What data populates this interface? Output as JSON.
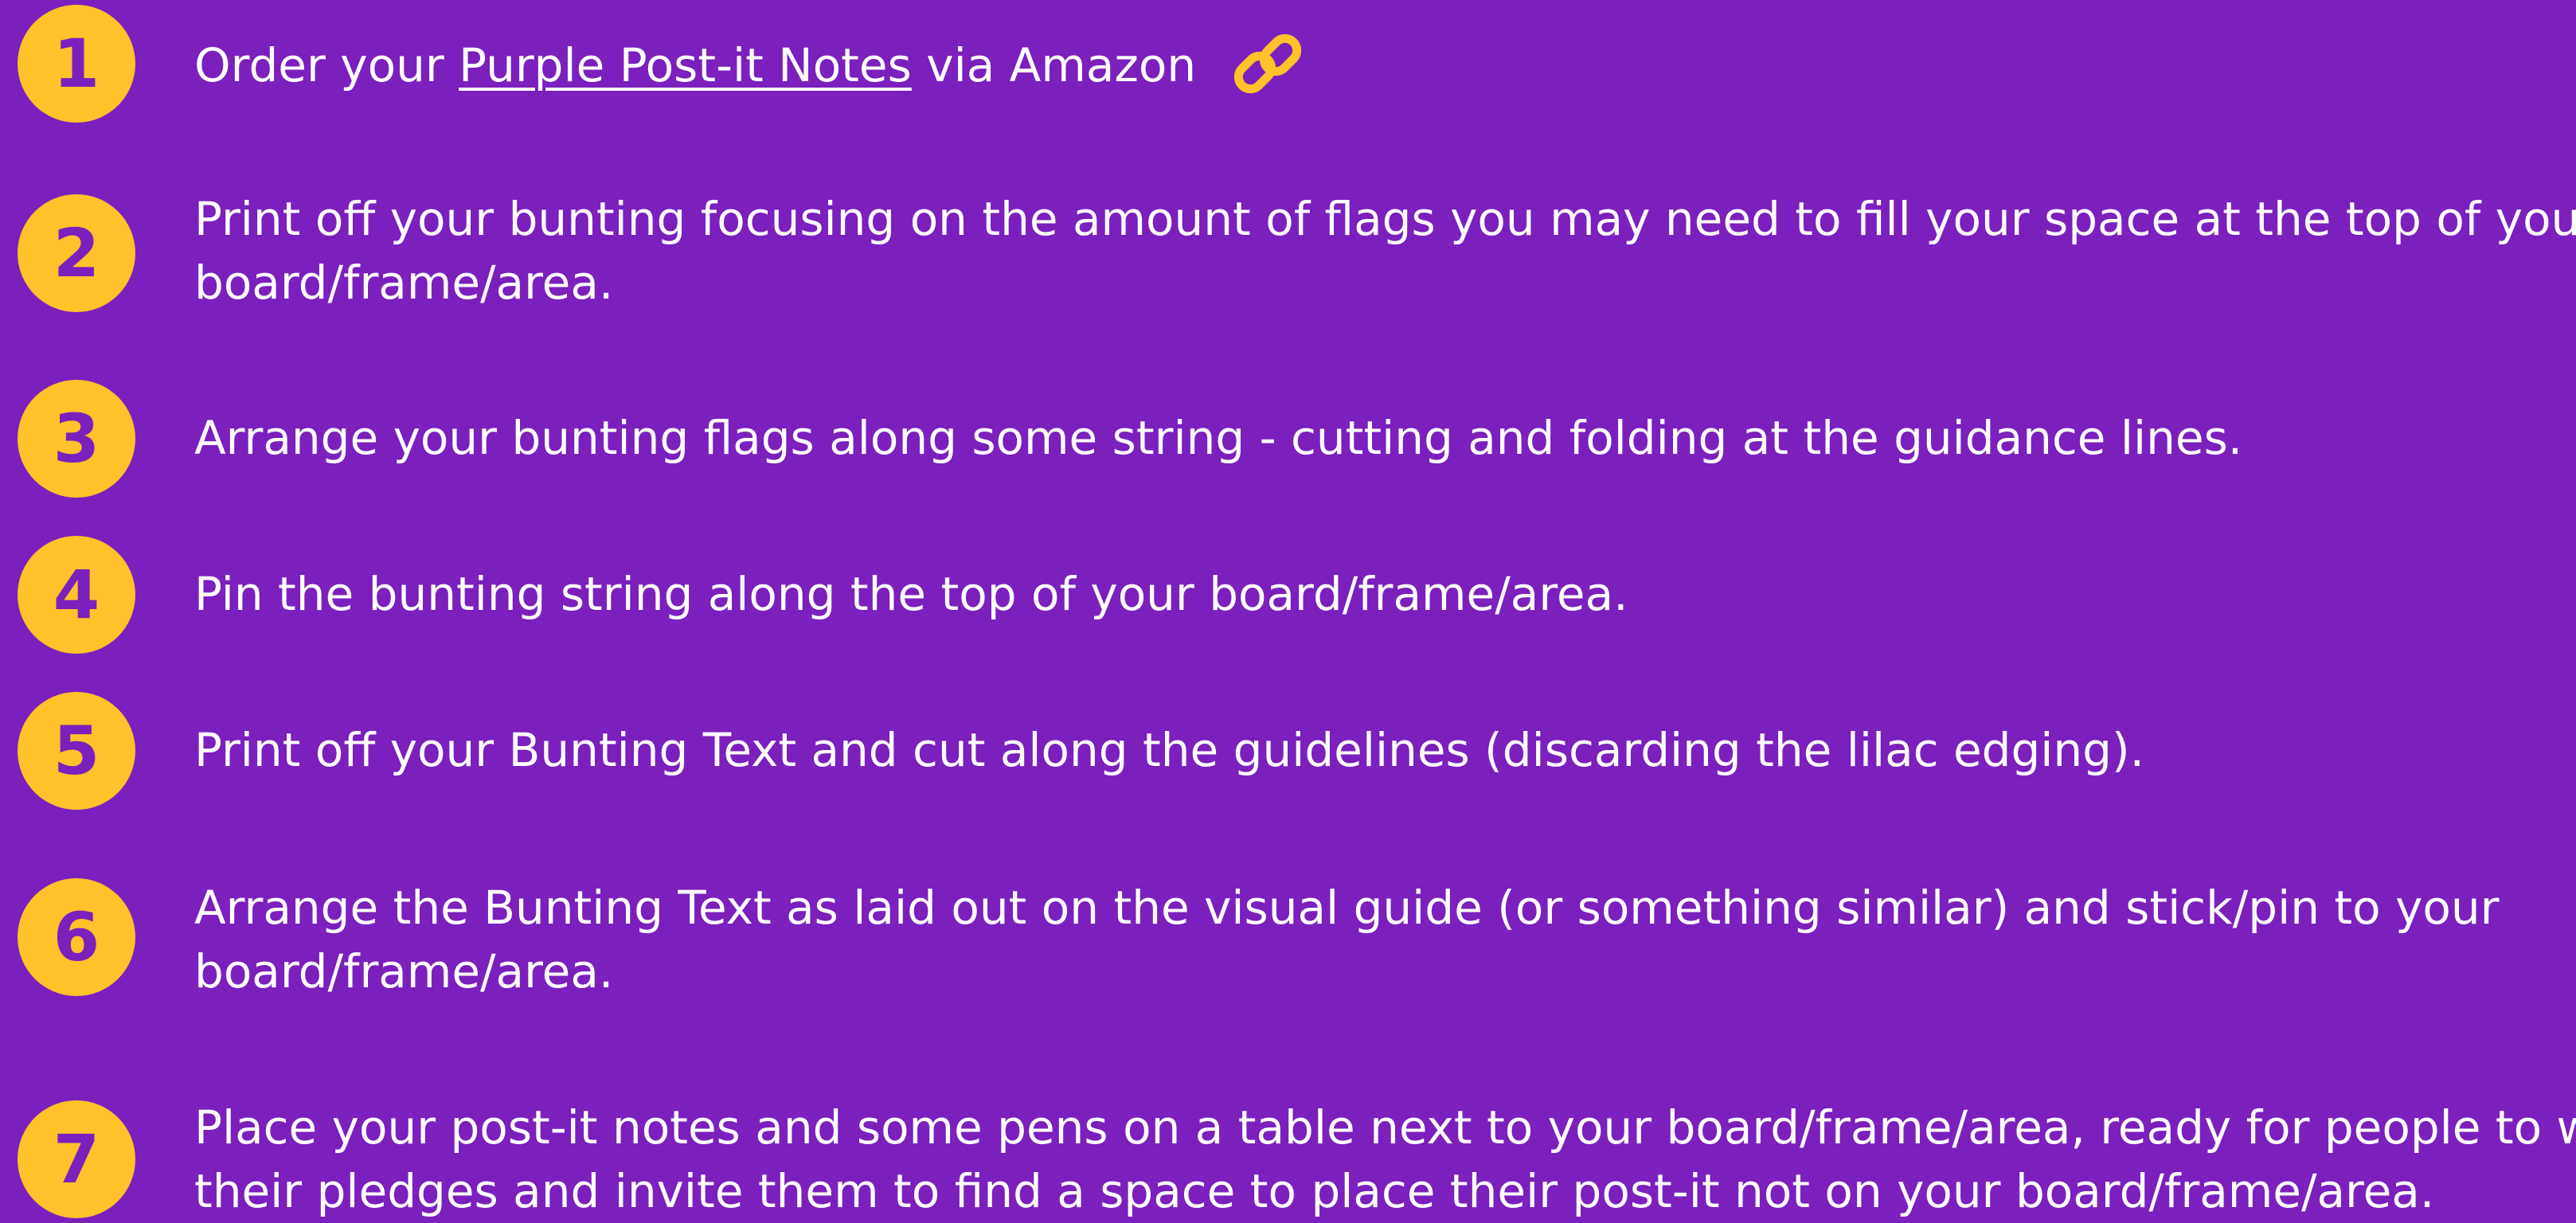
{
  "colors": {
    "background": "#7b1fbd",
    "badge": "#ffc22b",
    "badge_text": "#7b1fbd",
    "text": "#ffffff"
  },
  "steps": [
    {
      "number": "1",
      "parts": {
        "before": "Order your",
        "link": "Purple Post-it Notes",
        "after": "via Amazon"
      },
      "icon": "chain-link-icon"
    },
    {
      "number": "2",
      "lines": [
        "Print off your bunting focusing on the amount of flags you may need to fill your space at the top of your",
        "board/frame/area."
      ]
    },
    {
      "number": "3",
      "lines": [
        "Arrange your bunting flags along some string - cutting and folding at the guidance lines."
      ]
    },
    {
      "number": "4",
      "lines": [
        "Pin the bunting string along the top of your board/frame/area."
      ]
    },
    {
      "number": "5",
      "lines": [
        "Print off your Bunting Text and cut along the guidelines (discarding the lilac edging)."
      ]
    },
    {
      "number": "6",
      "lines": [
        "Arrange the Bunting Text as laid out on the visual guide (or something similar) and stick/pin to your",
        "board/frame/area."
      ]
    },
    {
      "number": "7",
      "lines": [
        "Place your post-it notes and some pens on a table next to your board/frame/area, ready for people to write",
        "their pledges and invite them to find a space to place their post-it not on your board/frame/area."
      ]
    }
  ]
}
